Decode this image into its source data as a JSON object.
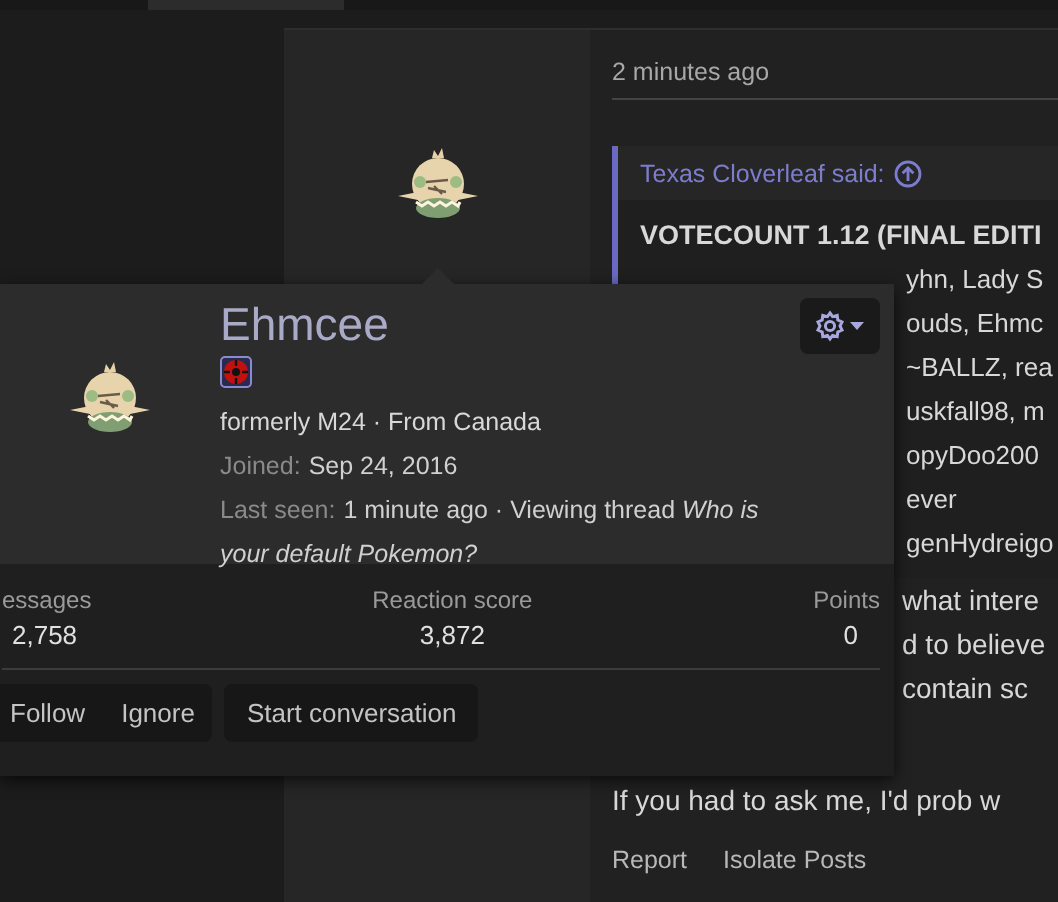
{
  "post": {
    "timestamp": "2 minutes ago",
    "quote": {
      "author": "Texas Cloverleaf said:",
      "title": "VOTECOUNT 1.12 (FINAL EDITI",
      "lines": [
        "yhn, Lady S",
        "ouds, Ehmc",
        "~BALLZ, rea",
        "uskfall98, m",
        "opyDoo200",
        "ever",
        "genHydreigo"
      ]
    },
    "body_fragments": [
      "what intere",
      "d to believe",
      "contain sc"
    ],
    "body_text": "If you had to ask me, I'd prob w",
    "actions": [
      "Report",
      "Isolate Posts"
    ]
  },
  "profile_card": {
    "name": "Ehmcee",
    "details": "formerly M24 · From Canada",
    "joined_label": "Joined:",
    "joined": "Sep 24, 2016",
    "last_seen_label": "Last seen:",
    "last_seen": "1 minute ago · Viewing thread *Who is your default Pokemon?*",
    "stats": [
      {
        "label": "essages",
        "value": "2,758"
      },
      {
        "label": "Reaction score",
        "value": "3,872"
      },
      {
        "label": "Points",
        "value": "0"
      }
    ],
    "buttons": [
      "Follow",
      "Ignore"
    ],
    "start_button": "Start conversation"
  }
}
